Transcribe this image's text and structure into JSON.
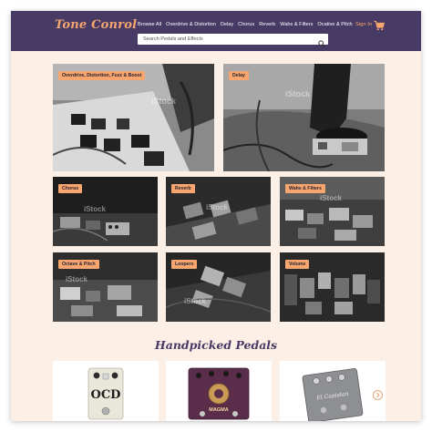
{
  "brand": {
    "name": "Tone Conrol"
  },
  "nav": {
    "items": [
      "Browse All",
      "Overdrive & Distortion",
      "Delay",
      "Chorus",
      "Reverb",
      "Wahs & Filters",
      "Ocative & Pitch"
    ],
    "signin": "Sign In"
  },
  "search": {
    "placeholder": "Search Pedals and Effects"
  },
  "tiles": [
    {
      "label": "Overdrive, Distortion, Fuzz & Boost",
      "watermark": "iStock"
    },
    {
      "label": "Delay",
      "watermark": "iStock"
    },
    {
      "label": "Chorus",
      "watermark": "iStock"
    },
    {
      "label": "Reverb",
      "watermark": "iStock"
    },
    {
      "label": "Wahs & Filters",
      "watermark": "iStock"
    },
    {
      "label": "Octave & Pitch",
      "watermark": "iStock"
    },
    {
      "label": "Loopers",
      "watermark": "iStock"
    },
    {
      "label": "Volume",
      "watermark": "iStock"
    }
  ],
  "handpicked": {
    "title": "Handpicked Pedals",
    "products": [
      {
        "name": "OCD",
        "pedal_text": "OCD",
        "color": "#e9e6da"
      },
      {
        "name": "Magma",
        "pedal_text": "MAGMA",
        "color": "#5a2d4a"
      },
      {
        "name": "El Capistan",
        "pedal_text": "El Capistan",
        "color": "#8e8f93"
      }
    ]
  },
  "colors": {
    "header": "#473b66",
    "accent": "#f6a66e",
    "background": "#fcefe6"
  },
  "icons": {
    "cart": "cart-icon",
    "search": "search-icon",
    "prev": "chevron-left-icon",
    "next": "chevron-right-icon"
  }
}
